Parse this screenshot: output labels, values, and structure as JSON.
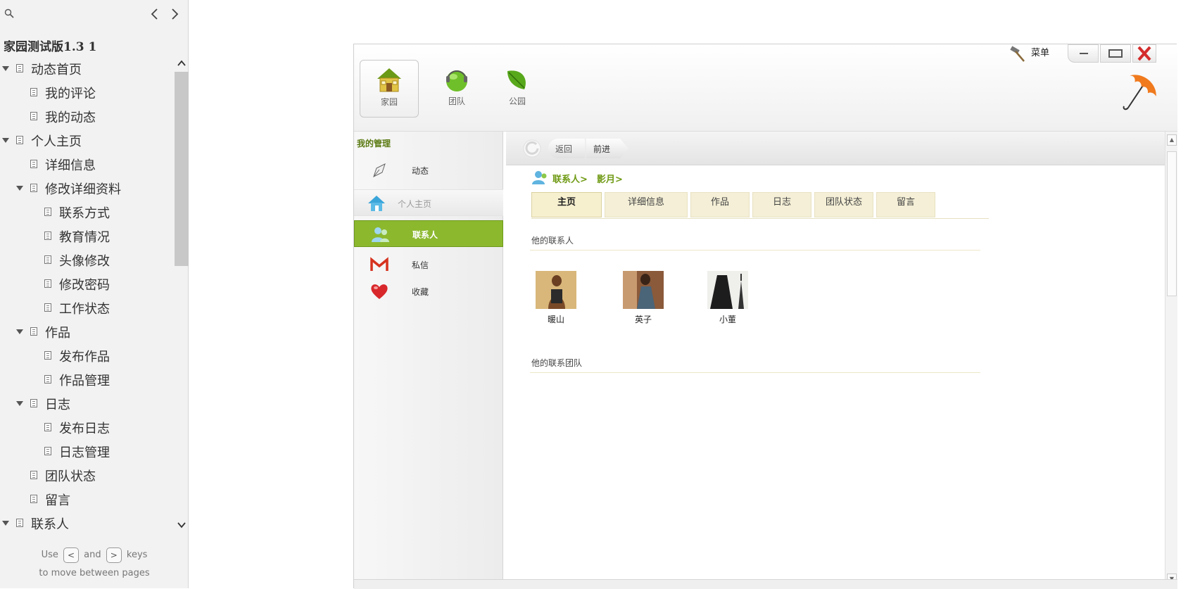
{
  "outline": {
    "doc_title": "家园测试版1.3 1",
    "nodes": [
      {
        "label": "动态首页",
        "level": 0,
        "expanded": true
      },
      {
        "label": "我的评论",
        "level": 1,
        "expanded": false
      },
      {
        "label": "我的动态",
        "level": 1,
        "expanded": false
      },
      {
        "label": "个人主页",
        "level": 0,
        "expanded": true
      },
      {
        "label": "详细信息",
        "level": 1,
        "expanded": false
      },
      {
        "label": "修改详细资料",
        "level": 1,
        "expanded": true
      },
      {
        "label": "联系方式",
        "level": 2,
        "expanded": false
      },
      {
        "label": "教育情况",
        "level": 2,
        "expanded": false
      },
      {
        "label": "头像修改",
        "level": 2,
        "expanded": false
      },
      {
        "label": "修改密码",
        "level": 2,
        "expanded": false
      },
      {
        "label": "工作状态",
        "level": 2,
        "expanded": false
      },
      {
        "label": "作品",
        "level": 1,
        "expanded": true
      },
      {
        "label": "发布作品",
        "level": 2,
        "expanded": false
      },
      {
        "label": "作品管理",
        "level": 2,
        "expanded": false
      },
      {
        "label": "日志",
        "level": 1,
        "expanded": true
      },
      {
        "label": "发布日志",
        "level": 2,
        "expanded": false
      },
      {
        "label": "日志管理",
        "level": 2,
        "expanded": false
      },
      {
        "label": "团队状态",
        "level": 1,
        "expanded": false
      },
      {
        "label": "留言",
        "level": 1,
        "expanded": false
      },
      {
        "label": "联系人",
        "level": 0,
        "expanded": true
      }
    ],
    "hint": {
      "use": "Use",
      "key_prev": "<",
      "and": "and",
      "key_next": ">",
      "keys": "keys",
      "line2": "to move between pages"
    }
  },
  "app": {
    "nav_tabs": [
      {
        "label": "家园",
        "icon": "house-icon",
        "active": true
      },
      {
        "label": "团队",
        "icon": "team-globe-icon",
        "active": false
      },
      {
        "label": "公园",
        "icon": "leaf-icon",
        "active": false
      }
    ],
    "menu_label": "菜单",
    "sidebar": {
      "title": "我的管理",
      "items": [
        {
          "label": "动态",
          "icon": "pen-icon",
          "state": "normal"
        },
        {
          "label": "个人主页",
          "icon": "home-icon",
          "state": "faded"
        },
        {
          "label": "联系人",
          "icon": "contacts-icon",
          "state": "selected"
        },
        {
          "label": "私信",
          "icon": "mail-icon",
          "state": "normal"
        },
        {
          "label": "收藏",
          "icon": "heart-icon",
          "state": "normal"
        }
      ]
    },
    "toolbar": {
      "back": "返回",
      "forward": "前进"
    },
    "breadcrumb": [
      "联系人>",
      "影月>"
    ],
    "tabs": [
      "主页",
      "详细信息",
      "作品",
      "日志",
      "团队状态",
      "留言"
    ],
    "active_tab": "主页",
    "sections": {
      "contacts_title": "他的联系人",
      "teams_title": "他的联系团队"
    },
    "contacts": [
      {
        "name": "暖山"
      },
      {
        "name": "英子"
      },
      {
        "name": "小董"
      }
    ],
    "colors": {
      "accent_green": "#8cb82e",
      "crumb_green": "#6f9a14",
      "tab_beige": "#f4efd6",
      "close_red": "#d42b2b"
    }
  }
}
